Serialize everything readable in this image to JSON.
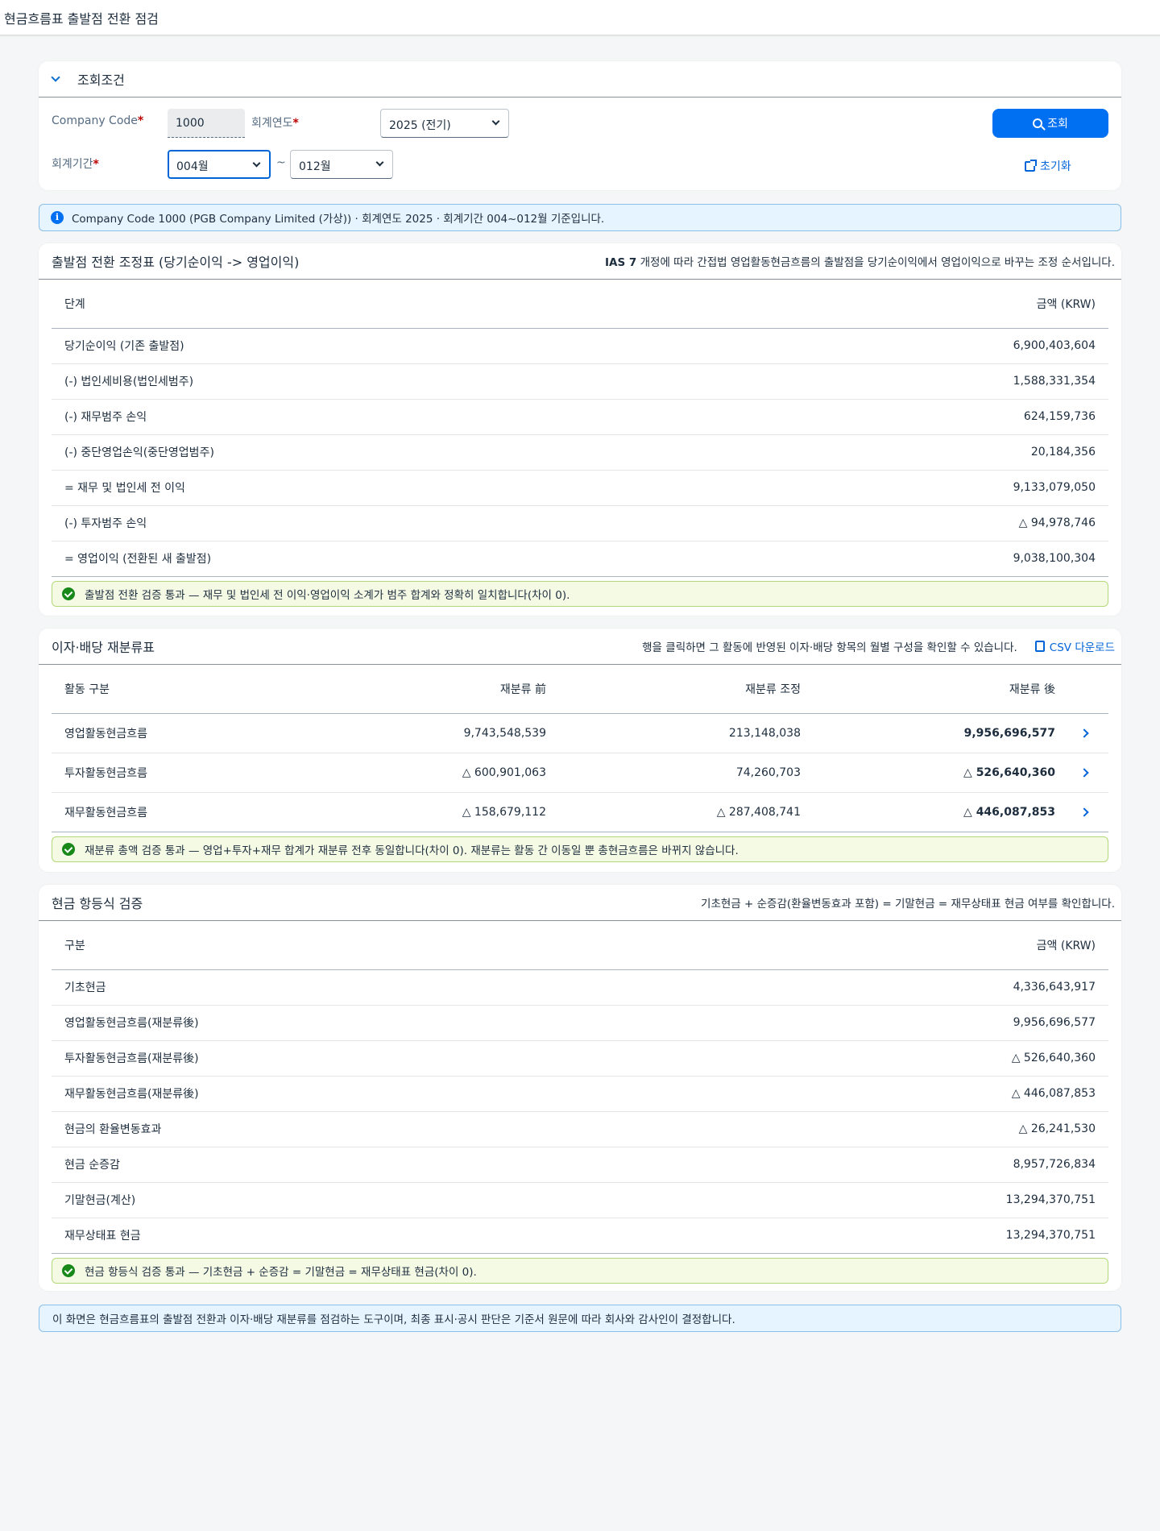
{
  "shell": {
    "title": "현금흐름표 출발점 전환 점검"
  },
  "filter": {
    "header": "조회조건",
    "company_code_label": "Company Code",
    "company_code_value": "1000",
    "fiscal_year_label": "회계연도",
    "fiscal_year_value": "2025 (전기)",
    "period_label": "회계기간",
    "period_from": "004월",
    "period_sep": "~",
    "period_to": "012월",
    "search_label": "조회",
    "reset_label": "초기화",
    "required_mark": "*"
  },
  "info_strip": "Company Code 1000 (PGB Company Limited (가상)) · 회계연도 2025 · 회계기간 004~012월 기준입니다.",
  "adjust": {
    "title": "출발점 전환 조정표 (당기순이익 -> 영업이익)",
    "note_bold": "IAS 7",
    "note_rest": " 개정에 따라 간접법 영업활동현금흐름의 출발점을 당기순이익에서 영업이익으로 바꾸는 조정 순서입니다.",
    "col_step": "단계",
    "col_amount": "금액 (KRW)",
    "rows": [
      {
        "label": "당기순이익 (기존 출발점)",
        "amount": "6,900,403,604"
      },
      {
        "label": "(-) 법인세비용(법인세범주)",
        "amount": "1,588,331,354"
      },
      {
        "label": "(-) 재무범주 손익",
        "amount": "624,159,736"
      },
      {
        "label": "(-) 중단영업손익(중단영업범주)",
        "amount": "20,184,356"
      },
      {
        "label": "= 재무 및 법인세 전 이익",
        "amount": "9,133,079,050"
      },
      {
        "label": "(-) 투자범주 손익",
        "amount": "△ 94,978,746"
      },
      {
        "label": "= 영업이익 (전환된 새 출발점)",
        "amount": "9,038,100,304"
      }
    ],
    "check": "출발점 전환 검증 통과 — 재무 및 법인세 전 이익·영업이익 소계가 범주 합계와 정확히 일치합니다(차이 0)."
  },
  "reclass": {
    "title": "이자·배당 재분류표",
    "note": "행을 클릭하면 그 활동에 반영된 이자·배당 항목의 월별 구성을 확인할 수 있습니다.",
    "csv_label": "CSV 다운로드",
    "col_activity": "활동 구분",
    "col_before": "재분류 前",
    "col_adjust": "재분류 조정",
    "col_after": "재분류 後",
    "rows": [
      {
        "activity": "영업활동현금흐름",
        "before": "9,743,548,539",
        "adjust": "213,148,038",
        "after": "9,956,696,577"
      },
      {
        "activity": "투자활동현금흐름",
        "before": "△ 600,901,063",
        "adjust": "74,260,703",
        "after": "△ 526,640,360"
      },
      {
        "activity": "재무활동현금흐름",
        "before": "△ 158,679,112",
        "adjust": "△ 287,408,741",
        "after": "△ 446,087,853"
      }
    ],
    "check": "재분류 총액 검증 통과 — 영업+투자+재무 합계가 재분류 전후 동일합니다(차이 0). 재분류는 활동 간 이동일 뿐 총현금흐름은 바뀌지 않습니다."
  },
  "identity": {
    "title": "현금 항등식 검증",
    "note": "기초현금 + 순증감(환율변동효과 포함) = 기말현금 = 재무상태표 현금 여부를 확인합니다.",
    "col_item": "구분",
    "col_amount": "금액 (KRW)",
    "rows": [
      {
        "label": "기초현금",
        "amount": "4,336,643,917"
      },
      {
        "label": "영업활동현금흐름(재분류後)",
        "amount": "9,956,696,577"
      },
      {
        "label": "투자활동현금흐름(재분류後)",
        "amount": "△ 526,640,360"
      },
      {
        "label": "재무활동현금흐름(재분류後)",
        "amount": "△ 446,087,853"
      },
      {
        "label": "현금의 환율변동효과",
        "amount": "△ 26,241,530"
      },
      {
        "label": "현금 순증감",
        "amount": "8,957,726,834"
      },
      {
        "label": "기말현금(계산)",
        "amount": "13,294,370,751"
      },
      {
        "label": "재무상태표 현금",
        "amount": "13,294,370,751"
      }
    ],
    "check": "현금 항등식 검증 통과 — 기초현금 + 순증감 = 기말현금 = 재무상태표 현금(차이 0)."
  },
  "footer_note": "이 화면은 현금흐름표의 출발점 전환과 이자·배당 재분류를 점검하는 도구이며, 최종 표시·공시 판단은 기준서 원문에 따라 회사와 감사인이 결정합니다."
}
